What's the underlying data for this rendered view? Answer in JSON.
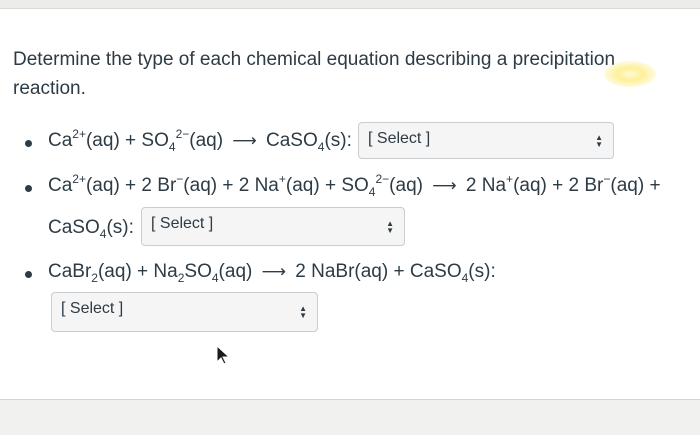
{
  "question": {
    "prompt": "Determine the type of each chemical equation describing a precipitation reaction."
  },
  "items": [
    {
      "reactants": [
        "Ca",
        "2+",
        "(aq) + SO",
        "4",
        "2−",
        "(aq)"
      ],
      "products": [
        "CaSO",
        "4",
        "(s):"
      ],
      "select_label": "[ Select ]"
    },
    {
      "line1_left": [
        "Ca",
        "2+",
        "(aq) + 2 Br",
        "−",
        "(aq) + 2 Na",
        "+",
        "(aq) + SO",
        "4",
        "2−",
        "(aq)"
      ],
      "line1_right": [
        "2 Na",
        "+",
        "(aq) + 2 Br",
        "−",
        "(aq) +"
      ],
      "line2": [
        "CaSO",
        "4",
        "(s):"
      ],
      "select_label": "[ Select ]"
    },
    {
      "reactants": [
        "CaBr",
        "2",
        "(aq) + Na",
        "2",
        "SO",
        "4",
        "(aq)"
      ],
      "products": [
        "2 NaBr(aq) + CaSO",
        "4",
        "(s):"
      ],
      "select_label": "[ Select ]"
    }
  ],
  "icons": {
    "dropdown": "sort-arrows-icon",
    "pointer": "mouse-cursor-icon"
  },
  "colors": {
    "text": "#2d3b45",
    "select_bg": "#f5f5f5",
    "select_border": "#c7cdd1"
  }
}
